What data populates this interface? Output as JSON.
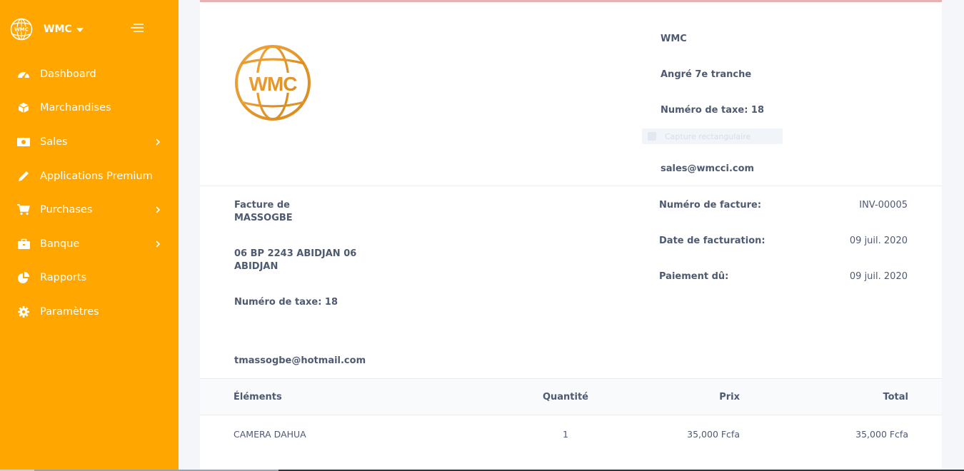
{
  "sidebar": {
    "brand": "WMC",
    "logo_text": "WMC",
    "items": [
      {
        "label": "Dashboard",
        "icon": "dashboard-icon",
        "has_submenu": false
      },
      {
        "label": "Marchandises",
        "icon": "cube-icon",
        "has_submenu": false
      },
      {
        "label": "Sales",
        "icon": "money-icon",
        "has_submenu": true
      },
      {
        "label": "Applications Premium",
        "icon": "pencil-icon",
        "has_submenu": false
      },
      {
        "label": "Purchases",
        "icon": "cart-icon",
        "has_submenu": true
      },
      {
        "label": "Banque",
        "icon": "briefcase-icon",
        "has_submenu": true
      },
      {
        "label": "Rapports",
        "icon": "pie-chart-icon",
        "has_submenu": false
      },
      {
        "label": "Paramètres",
        "icon": "gear-icon",
        "has_submenu": false
      }
    ]
  },
  "company": {
    "logo_text": "WMC",
    "name": "WMC",
    "address": "Angré 7e tranche",
    "tax": "Numéro de taxe: 18",
    "email": "sales@wmcci.com"
  },
  "overlay": {
    "label": "Capture rectangulaire"
  },
  "bill_to": {
    "heading": "Facture de",
    "name": "MASSOGBE",
    "address_line1": "06 BP 2243 ABIDJAN 06",
    "address_line2": "ABIDJAN",
    "tax": "Numéro de taxe: 18",
    "email": "tmassogbe@hotmail.com"
  },
  "invoice": {
    "number_label": "Numéro de facture:",
    "number_value": "INV-00005",
    "date_label": "Date de facturation:",
    "date_value": "09 juil. 2020",
    "due_label": "Paiement dû:",
    "due_value": "09 juil. 2020"
  },
  "table": {
    "headers": {
      "item": "Éléments",
      "qty": "Quantité",
      "price": "Prix",
      "total": "Total"
    },
    "rows": [
      {
        "item": "CAMERA DAHUA",
        "qty": "1",
        "price": "35,000 Fcfa",
        "total": "35,000 Fcfa"
      }
    ]
  },
  "colors": {
    "sidebar_bg": "#ffa601",
    "logo_orange": "#e8902a",
    "text": "#4e5a70",
    "accent_red": "#d9534f"
  }
}
